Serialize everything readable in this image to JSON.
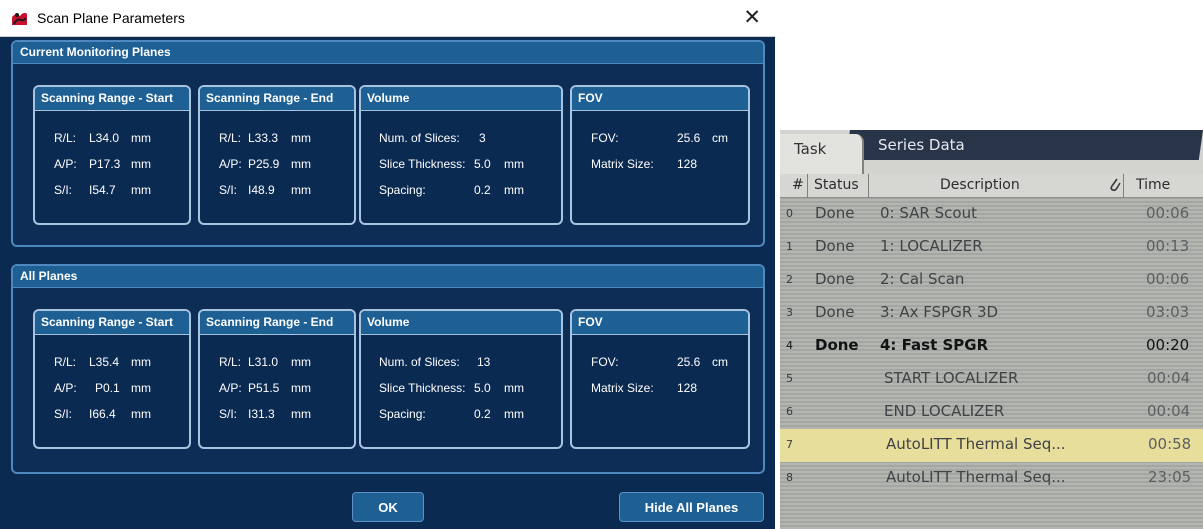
{
  "dialog": {
    "title": "Scan Plane Parameters",
    "close_icon": "close-icon",
    "app_icon": "app-icon",
    "sections": [
      {
        "title": "Current Monitoring Planes",
        "groups": {
          "start": {
            "title": "Scanning Range - Start",
            "rows": [
              {
                "label": "R/L:",
                "value": "L34.0",
                "unit": "mm"
              },
              {
                "label": "A/P:",
                "value": "P17.3",
                "unit": "mm"
              },
              {
                "label": "S/I:",
                "value": "I54.7",
                "unit": "mm"
              }
            ]
          },
          "end": {
            "title": "Scanning Range - End",
            "rows": [
              {
                "label": "R/L:",
                "value": "L33.3",
                "unit": "mm"
              },
              {
                "label": "A/P:",
                "value": "P25.9",
                "unit": "mm"
              },
              {
                "label": "S/I:",
                "value": "I48.9",
                "unit": "mm"
              }
            ]
          },
          "volume": {
            "title": "Volume",
            "rows": [
              {
                "label": "Num. of Slices:",
                "value": "3",
                "unit": ""
              },
              {
                "label": "Slice Thickness:",
                "value": "5.0",
                "unit": "mm"
              },
              {
                "label": "Spacing:",
                "value": "0.2",
                "unit": "mm"
              }
            ]
          },
          "fov": {
            "title": "FOV",
            "rows": [
              {
                "label": "FOV:",
                "value": "25.6",
                "unit": "cm"
              },
              {
                "label": "Matrix Size:",
                "value": "128",
                "unit": ""
              }
            ]
          }
        }
      },
      {
        "title": "All Planes",
        "groups": {
          "start": {
            "title": "Scanning Range - Start",
            "rows": [
              {
                "label": "R/L:",
                "value": "L35.4",
                "unit": "mm"
              },
              {
                "label": "A/P:",
                "value": "P0.1",
                "unit": "mm"
              },
              {
                "label": "S/I:",
                "value": "I66.4",
                "unit": "mm"
              }
            ]
          },
          "end": {
            "title": "Scanning Range - End",
            "rows": [
              {
                "label": "R/L:",
                "value": "L31.0",
                "unit": "mm"
              },
              {
                "label": "A/P:",
                "value": "P51.5",
                "unit": "mm"
              },
              {
                "label": "S/I:",
                "value": "I31.3",
                "unit": "mm"
              }
            ]
          },
          "volume": {
            "title": "Volume",
            "rows": [
              {
                "label": "Num. of Slices:",
                "value": "13",
                "unit": ""
              },
              {
                "label": "Slice Thickness:",
                "value": "5.0",
                "unit": "mm"
              },
              {
                "label": "Spacing:",
                "value": "0.2",
                "unit": "mm"
              }
            ]
          },
          "fov": {
            "title": "FOV",
            "rows": [
              {
                "label": "FOV:",
                "value": "25.6",
                "unit": "cm"
              },
              {
                "label": "Matrix Size:",
                "value": "128",
                "unit": ""
              }
            ]
          }
        }
      }
    ],
    "buttons": {
      "ok": "OK",
      "hide_all": "Hide All Planes"
    }
  },
  "photo": {
    "tabs": {
      "task": "Task",
      "series": "Series Data"
    },
    "columns": {
      "num": "#",
      "status": "Status",
      "description": "Description",
      "clip_icon": "paperclip-icon",
      "time": "Time"
    },
    "rows": [
      {
        "num": "0",
        "status": "Done",
        "description": "0: SAR Scout",
        "time": "00:06"
      },
      {
        "num": "1",
        "status": "Done",
        "description": "1: LOCALIZER",
        "time": "00:13"
      },
      {
        "num": "2",
        "status": "Done",
        "description": "2: Cal Scan",
        "time": "00:06"
      },
      {
        "num": "3",
        "status": "Done",
        "description": "3: Ax FSPGR 3D",
        "time": "03:03"
      },
      {
        "num": "4",
        "status": "Done",
        "description": "4: Fast SPGR",
        "time": "00:20"
      },
      {
        "num": "5",
        "status": "",
        "description": "START LOCALIZER",
        "time": "00:04"
      },
      {
        "num": "6",
        "status": "",
        "description": "END LOCALIZER",
        "time": "00:04"
      },
      {
        "num": "7",
        "status": "",
        "description": "AutoLITT Thermal Seq...",
        "time": "00:58"
      },
      {
        "num": "8",
        "status": "",
        "description": "AutoLITT Thermal Seq...",
        "time": "23:05"
      }
    ]
  }
}
